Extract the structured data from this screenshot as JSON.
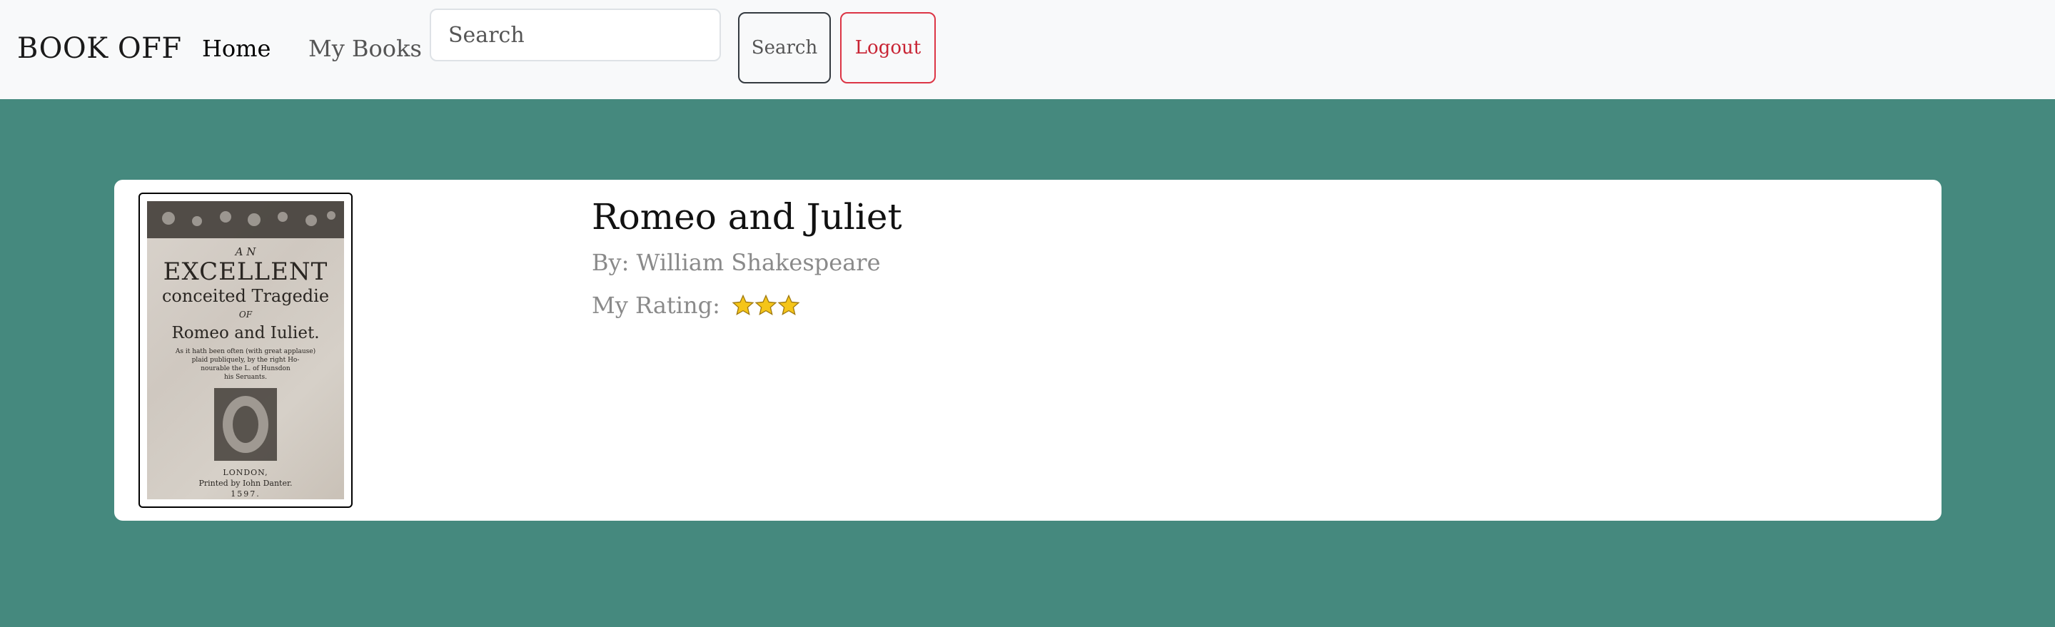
{
  "navbar": {
    "brand": "BOOK OFF",
    "links": [
      {
        "label": "Home",
        "active": true
      },
      {
        "label": "My Books",
        "active": false
      }
    ],
    "search": {
      "placeholder": "Search",
      "value": ""
    },
    "search_button": "Search",
    "logout_button": "Logout"
  },
  "book": {
    "title": "Romeo and Juliet",
    "author": "By: William Shakespeare",
    "rating_label": "My Rating:",
    "rating": 3,
    "cover": {
      "line1": "A N",
      "line2": "EXCELLENT",
      "line3": "conceited Tragedie",
      "line4": "OF",
      "line5": "Romeo and Iuliet.",
      "line6": "As it hath been often (with great applause)",
      "line7": "plaid publiquely, by the right Ho-",
      "line8": "nourable the L. of Hunsdon",
      "line9": "his Seruants.",
      "line10": "LONDON,",
      "line11": "Printed by Iohn Danter.",
      "line12": "1597."
    }
  },
  "colors": {
    "page_background": "#45897e",
    "navbar_background": "#f8f9fa",
    "logout": "#dc3545",
    "star": "#f5c518"
  }
}
